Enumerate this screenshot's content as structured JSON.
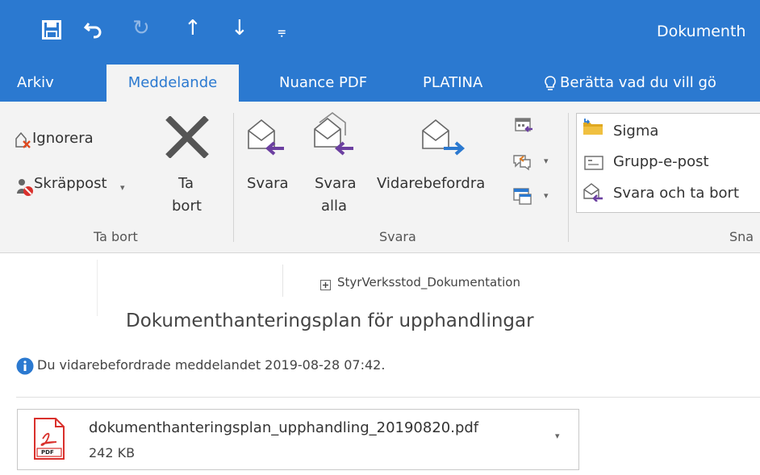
{
  "window": {
    "title": "Dokumenth"
  },
  "quick_access": {
    "redo_glyph": "↻",
    "up_glyph": "↑",
    "down_glyph": "↓",
    "customize_glyph": "⩦"
  },
  "tabs": [
    {
      "label": "Arkiv"
    },
    {
      "label": "Meddelande"
    },
    {
      "label": "Nuance PDF"
    },
    {
      "label": "PLATINA"
    }
  ],
  "tell_me": {
    "text": "Berätta vad du vill gö"
  },
  "ribbon": {
    "delete_group": {
      "label": "Ta bort",
      "ignore": "Ignorera",
      "junk": "Skräppost",
      "delete_line1": "Ta",
      "delete_line2": "bort"
    },
    "respond_group": {
      "label": "Svara",
      "reply": "Svara",
      "reply_all_line1": "Svara",
      "reply_all_line2": "alla",
      "forward": "Vidarebefordra"
    },
    "quick_steps_group": {
      "label": "Sna",
      "items": [
        "Sigma",
        "Grupp-e-post",
        "Svara och ta bort"
      ]
    }
  },
  "message": {
    "folder": "StyrVerksstod_Dokumentation",
    "subject": "Dokumenthanteringsplan för upphandlingar",
    "info": "Du vidarebefordrade meddelandet 2019-08-28 07:42.",
    "attachment": {
      "filename": "dokumenthanteringsplan_upphandling_20190820.pdf",
      "size": "242 KB",
      "type_label": "PDF"
    }
  },
  "colors": {
    "accent": "#2B79D0",
    "ribbon_bg": "#F3F3F3",
    "arrow_purple": "#6b3fa0",
    "arrow_blue": "#2b79d0",
    "pdf_red": "#d9302c"
  }
}
